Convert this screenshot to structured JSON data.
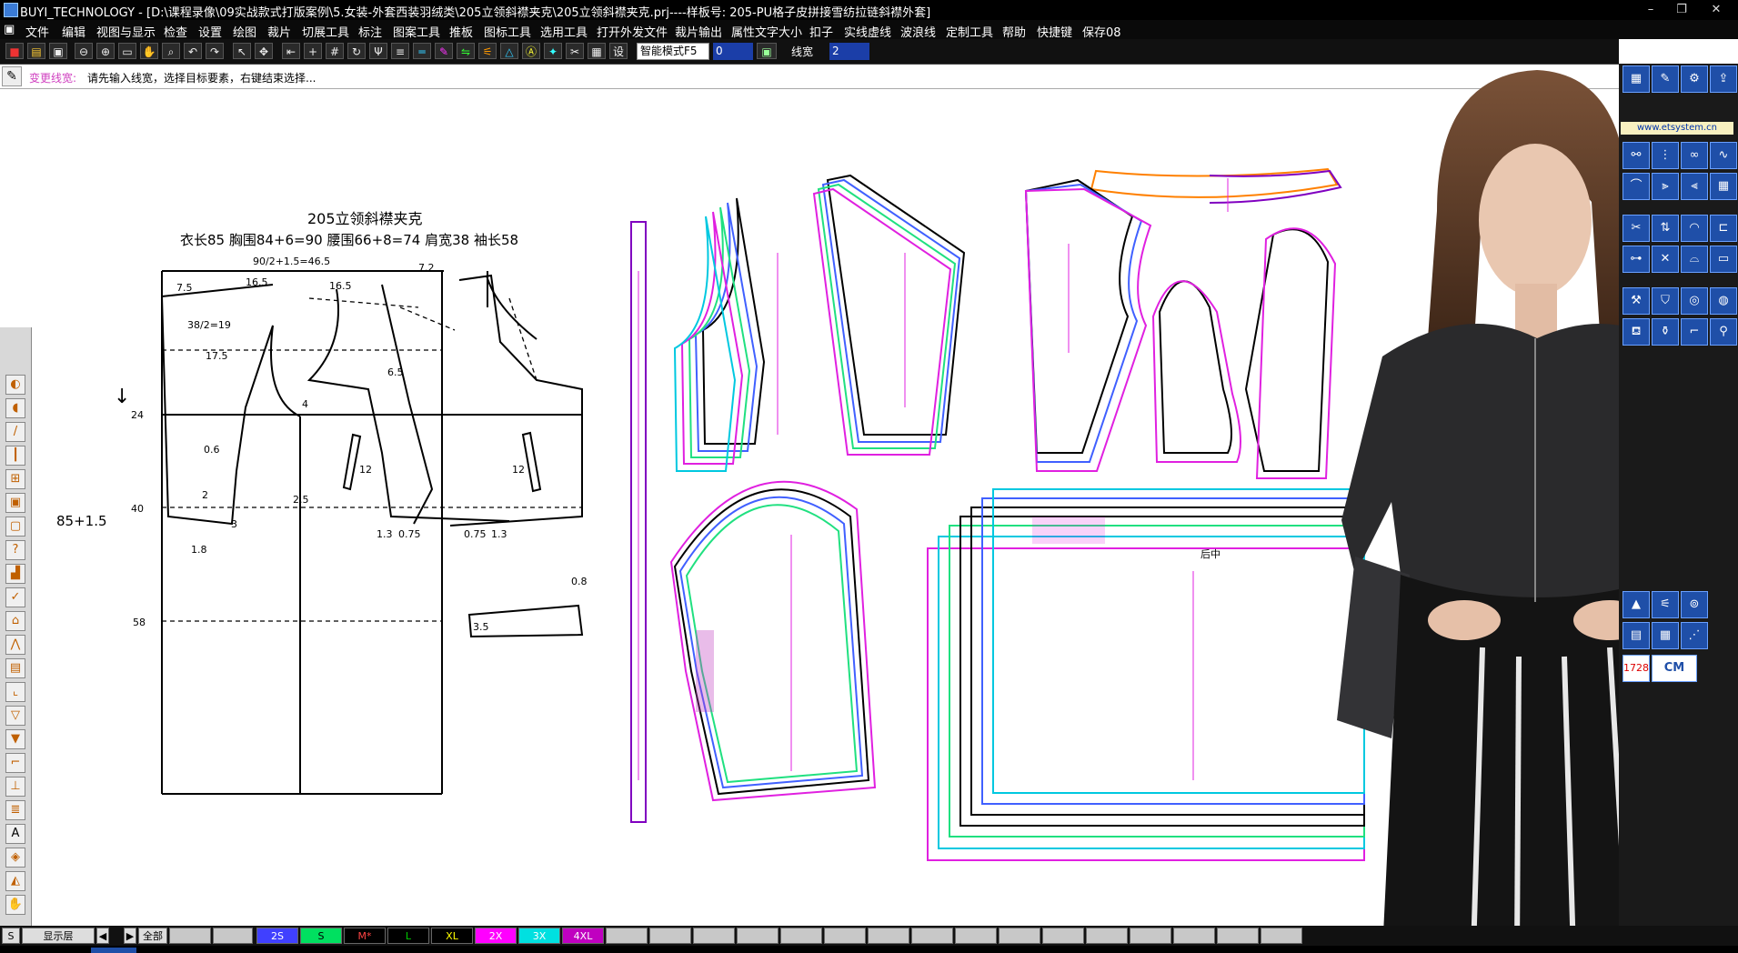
{
  "window": {
    "title": "BUYI_TECHNOLOGY - [D:\\课程录像\\09实战款式打版案例\\5.女装-外套西装羽绒类\\205立领斜襟夹克\\205立领斜襟夹克.prj----样板号: 205-PU格子皮拼接雪纺拉链斜襟外套]",
    "minimize": "–",
    "maximize": "❐",
    "close": "✕"
  },
  "menu": [
    "文件",
    "编辑",
    "视图与显示",
    "检查",
    "设置",
    "绘图",
    "裁片",
    "切展工具",
    "标注",
    "图案工具",
    "推板",
    "图标工具",
    "选用工具",
    "打开外发文件",
    "裁片输出",
    "属性文字大小",
    "扣子",
    "实线虚线",
    "波浪线",
    "定制工具",
    "帮助",
    "快捷键",
    "保存08"
  ],
  "toolbar": {
    "mode_select": "智能模式F5",
    "value_field": "0",
    "width_label": "线宽",
    "width_value": "2"
  },
  "status": {
    "command": "变更线宽:",
    "hint": "请先输入线宽，选择目标要素，右键结束选择..."
  },
  "pattern": {
    "title": "205立领斜襟夹克",
    "specs": "衣长85   胸围84+6=90   腰围66+8=74   肩宽38   袖长58",
    "formula": "90/2+1.5=46.5",
    "lbl_75": "7.5",
    "lbl_165a": "16.5",
    "lbl_165b": "16.5",
    "lbl_72": "7.2",
    "lbl_38": "38/2=19",
    "lbl_175": "17.5",
    "lbl_24": "24",
    "lbl_40": "40",
    "lbl_58": "58",
    "lbl_hip": "85+1.5",
    "lbl_06": "0.6",
    "lbl_2": "2",
    "lbl_18": "1.8",
    "lbl_3": "3",
    "lbl_4": "4",
    "lbl_25": "2.5",
    "lbl_12a": "12",
    "lbl_12b": "12",
    "lbl_13a": "1.3",
    "lbl_075a": "0.75",
    "lbl_075b": "0.75",
    "lbl_13b": "1.3",
    "lbl_65": "6.5",
    "lbl_08": "0.8",
    "lbl_35": "3.5",
    "piece_back": "后中"
  },
  "rightpanel": {
    "url": "www.etsystem.cn",
    "size_badge": "1728",
    "unit": "CM"
  },
  "bottombar": {
    "s_btn": "S",
    "layer": "显示层",
    "all": "全部",
    "sizes": [
      "2S",
      "S",
      "M*",
      "L",
      "XL",
      "2X",
      "3X",
      "4XL"
    ],
    "size_colors": [
      "#4040ff",
      "#00e060",
      "#000000",
      "#00c000",
      "#000000",
      "#ff00ff",
      "#00e0e0",
      "#c000c0"
    ]
  },
  "colors": {
    "sizeline_cyan": "#00c8e0",
    "sizeline_green": "#20e080",
    "sizeline_magenta": "#e020e0",
    "sizeline_blue": "#4060ff",
    "sizeline_orange": "#ff8000"
  }
}
